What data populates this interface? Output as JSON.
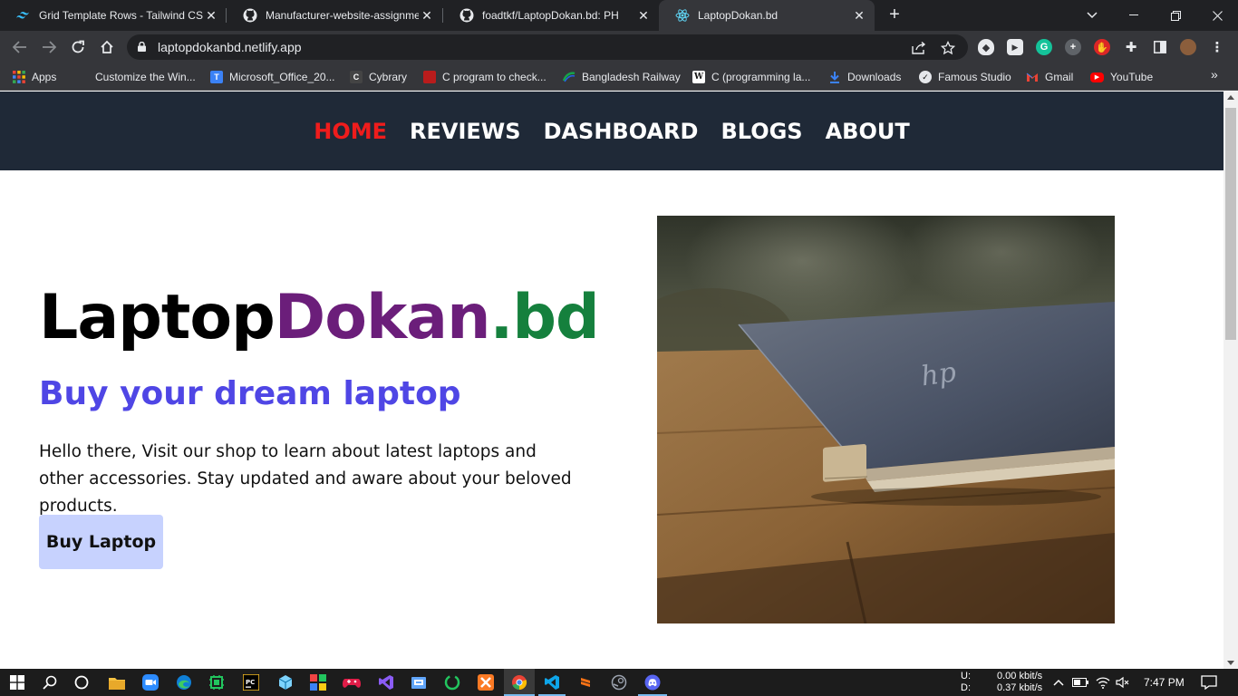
{
  "browser": {
    "tabs": [
      {
        "title": "Grid Template Rows - Tailwind CS",
        "icon": "tailwind-icon"
      },
      {
        "title": "Manufacturer-website-assignmen",
        "icon": "github-icon"
      },
      {
        "title": "foadtkf/LaptopDokan.bd: PH",
        "icon": "github-icon"
      },
      {
        "title": "LaptopDokan.bd",
        "icon": "react-icon",
        "active": true
      }
    ],
    "url": "laptopdokanbd.netlify.app",
    "bookmarks": [
      {
        "label": "Apps",
        "icon": "apps-grid-icon",
        "color": "#f4b400"
      },
      {
        "label": "Customize the Win...",
        "icon": "blank-page-icon",
        "color": "#35363a"
      },
      {
        "label": "Microsoft_Office_20...",
        "icon": "t-logo-icon",
        "color": "#3b82f6"
      },
      {
        "label": "Cybrary",
        "icon": "cybrary-icon",
        "color": "#444444"
      },
      {
        "label": "C program to check...",
        "icon": "book-icon",
        "color": "#b91c1c"
      },
      {
        "label": "Bangladesh Railway",
        "icon": "railway-icon",
        "color": "#16a34a"
      },
      {
        "label": "C (programming la...",
        "icon": "wikipedia-icon",
        "color": "#ffffff"
      },
      {
        "label": "Downloads",
        "icon": "download-icon",
        "color": "#3b82f6"
      },
      {
        "label": "Famous Studio",
        "icon": "studio-icon",
        "color": "#e5e7eb"
      },
      {
        "label": "Gmail",
        "icon": "gmail-icon",
        "color": "#ea4335"
      },
      {
        "label": "YouTube",
        "icon": "youtube-icon",
        "color": "#ff0000"
      }
    ]
  },
  "site": {
    "nav": [
      "HOME",
      "REVIEWS",
      "DASHBOARD",
      "BLOGS",
      "ABOUT"
    ],
    "active_nav": "HOME",
    "brand": {
      "part1": "Laptop",
      "part2": "Dokan",
      "part3": ".bd"
    },
    "subtitle": "Buy your dream laptop",
    "description": "Hello there, Visit our shop to learn about latest laptops and other accessories. Stay updated and aware about your beloved products.",
    "cta": "Buy Laptop",
    "colors": {
      "nav_bg": "#1f2937",
      "active": "#ef1c1c",
      "dokan": "#6b1e7a",
      "bd": "#15803d",
      "subtitle": "#4f46e5",
      "button": "#c7d2fe"
    }
  },
  "taskbar": {
    "net_up_label": "U:",
    "net_down_label": "D:",
    "net_up": "0.00 kbit/s",
    "net_down": "0.37 kbit/s",
    "time": "7:47 PM"
  }
}
